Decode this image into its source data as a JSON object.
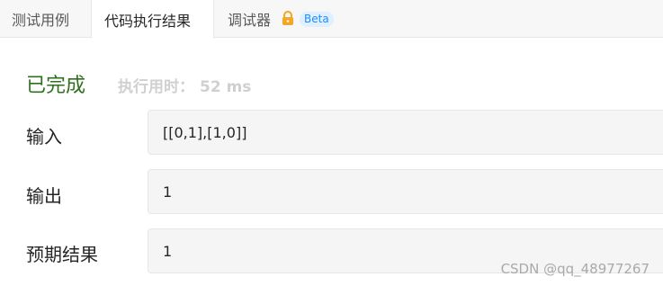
{
  "tabs": {
    "testcase": "测试用例",
    "result": "代码执行结果",
    "debugger": "调试器",
    "beta": "Beta"
  },
  "icons": {
    "lock": "lock-icon"
  },
  "colors": {
    "status_success": "#2f6f1e",
    "lock": "#f5a623",
    "beta_text": "#1a90ff"
  },
  "result": {
    "status": "已完成",
    "runtime_label": "执行用时：",
    "runtime_value": "52 ms"
  },
  "fields": {
    "input_label": "输入",
    "input_value": "[[0,1],[1,0]]",
    "output_label": "输出",
    "output_value": "1",
    "expected_label": "预期结果",
    "expected_value": "1"
  },
  "watermark": "CSDN @qq_48977267"
}
